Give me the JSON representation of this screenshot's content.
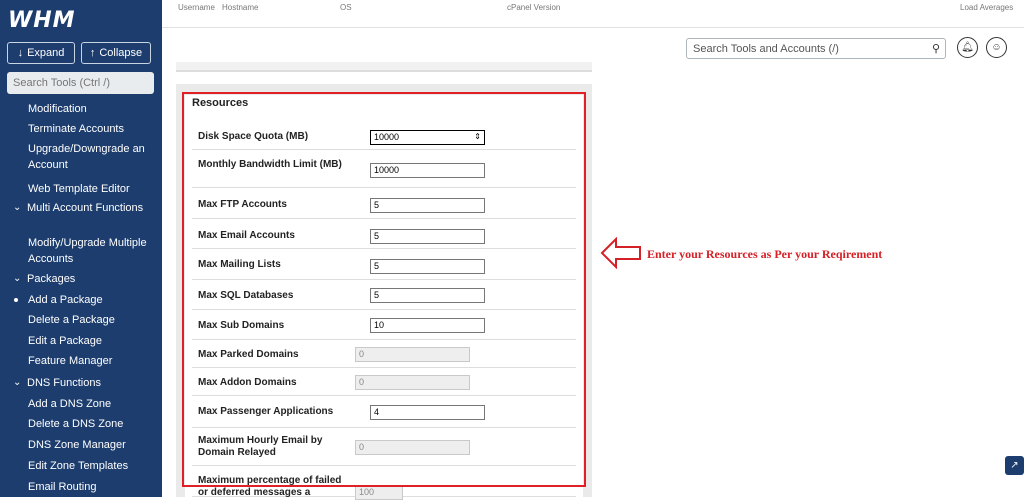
{
  "sidebar": {
    "logo": "WHM",
    "expand_label": "Expand",
    "collapse_label": "Collapse",
    "search_placeholder": "Search Tools (Ctrl /)",
    "items": [
      {
        "label": "Modification",
        "type": "item"
      },
      {
        "label": "Terminate Accounts",
        "type": "item"
      },
      {
        "label": "Upgrade/Downgrade an Account",
        "type": "item"
      },
      {
        "label": "Web Template Editor",
        "type": "item"
      },
      {
        "label": "Multi Account Functions",
        "type": "section"
      },
      {
        "label": "Modify/Upgrade Multiple Accounts",
        "type": "item"
      },
      {
        "label": "Packages",
        "type": "section"
      },
      {
        "label": "Add a Package",
        "type": "active"
      },
      {
        "label": "Delete a Package",
        "type": "item"
      },
      {
        "label": "Edit a Package",
        "type": "item"
      },
      {
        "label": "Feature Manager",
        "type": "item"
      },
      {
        "label": "DNS Functions",
        "type": "section"
      },
      {
        "label": "Add a DNS Zone",
        "type": "item"
      },
      {
        "label": "Delete a DNS Zone",
        "type": "item"
      },
      {
        "label": "DNS Zone Manager",
        "type": "item"
      },
      {
        "label": "Edit Zone Templates",
        "type": "item"
      },
      {
        "label": "Email Routing",
        "type": "item"
      }
    ]
  },
  "topbar": {
    "username": "Username",
    "hostname": "Hostname",
    "os": "OS",
    "cpanel_version": "cPanel Version",
    "load_averages": "Load Averages"
  },
  "header": {
    "search_placeholder": "Search Tools and Accounts (/)",
    "search_icon": "search-icon",
    "bell_icon": "bell-icon",
    "user_icon": "user-icon"
  },
  "resources": {
    "title": "Resources",
    "rows": [
      {
        "label": "Disk Space Quota (MB)",
        "value": "10000",
        "disabled": false
      },
      {
        "label": "Monthly Bandwidth Limit (MB)",
        "value": "10000",
        "disabled": false
      },
      {
        "label": "Max FTP Accounts",
        "value": "5",
        "disabled": false
      },
      {
        "label": "Max Email Accounts",
        "value": "5",
        "disabled": false
      },
      {
        "label": "Max Mailing Lists",
        "value": "5",
        "disabled": false
      },
      {
        "label": "Max SQL Databases",
        "value": "5",
        "disabled": false
      },
      {
        "label": "Max Sub Domains",
        "value": "10",
        "disabled": false
      },
      {
        "label": "Max Parked Domains",
        "value": "0",
        "disabled": true
      },
      {
        "label": "Max Addon Domains",
        "value": "0",
        "disabled": true
      },
      {
        "label": "Max Passenger Applications",
        "value": "4",
        "disabled": false
      },
      {
        "label": "Maximum Hourly Email by Domain Relayed",
        "value": "0",
        "disabled": true
      },
      {
        "label": "Maximum percentage of failed or deferred messages a",
        "value": "100",
        "disabled": true
      }
    ]
  },
  "annotation": {
    "text": "Enter your Resources as Per your Reqirement",
    "color": "#d42127"
  },
  "colors": {
    "sidebar_bg": "#1c3d6e",
    "highlight_red": "#e02027"
  }
}
